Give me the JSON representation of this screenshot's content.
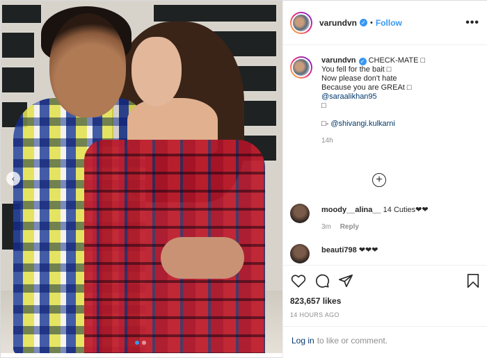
{
  "post": {
    "username": "varundvn",
    "follow_label": "Follow",
    "separator": "•",
    "more_label": "•••"
  },
  "caption": {
    "username": "varundvn",
    "lines": [
      "CHECK-MATE □",
      "You fell for the bait □",
      "Now please don't hate",
      "Because you are GREAt □"
    ],
    "mention": "@saraalikhan95",
    "glyph": "□",
    "credit_prefix": "□- ",
    "credit_mention": "@shivangi.kulkarni",
    "time": "14h"
  },
  "comments": [
    {
      "username": "moody__alina__",
      "text": "14 Cuties❤❤",
      "time": "3m",
      "reply": "Reply"
    },
    {
      "username": "beauti798",
      "text": "❤❤❤"
    }
  ],
  "actions": {
    "icons": [
      "heart-icon",
      "comment-icon",
      "share-icon",
      "bookmark-icon"
    ],
    "likes": "823,657 likes",
    "ago": "14 HOURS AGO"
  },
  "login": {
    "link": "Log in",
    "text": "to like or comment."
  },
  "colors": {
    "accent": "#3897f0",
    "link": "#00376b",
    "muted": "#8e8e8e",
    "text": "#262626"
  }
}
